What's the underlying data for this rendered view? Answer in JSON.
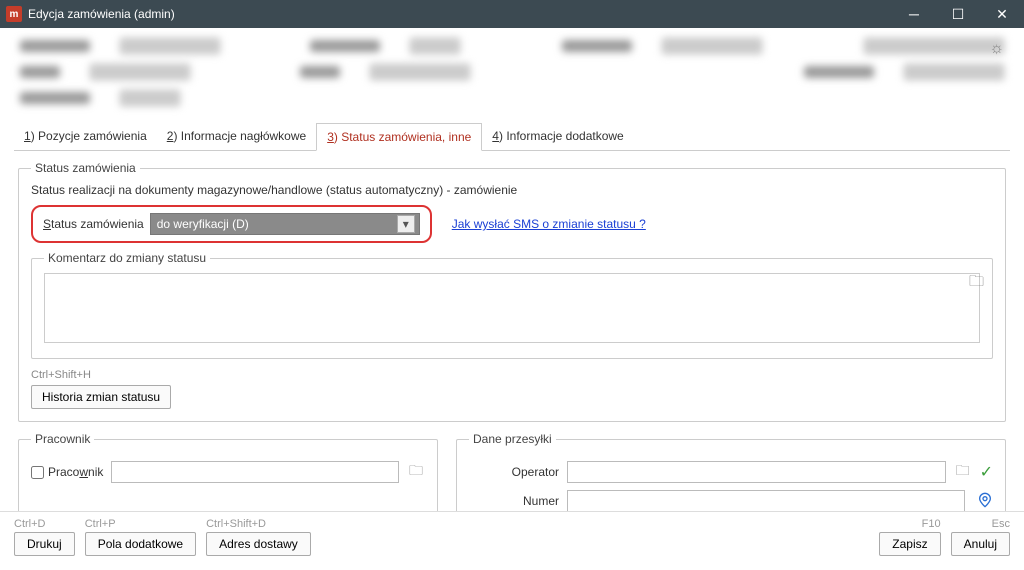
{
  "window": {
    "title": "Edycja zamówienia (admin)"
  },
  "tabs": [
    {
      "num": "1",
      "label": "Pozycje zamówienia"
    },
    {
      "num": "2",
      "label": "Informacje nagłówkowe"
    },
    {
      "num": "3",
      "label": "Status zamówienia, inne"
    },
    {
      "num": "4",
      "label": "Informacje dodatkowe"
    }
  ],
  "status": {
    "legend": "Status zamówienia",
    "auto_line": "Status realizacji na dokumenty magazynowe/handlowe (status automatyczny)  -  zamówienie",
    "field_label": "Status zamówienia",
    "field_label_ul": "S",
    "value": "do weryfikacji (D)",
    "sms_link": "Jak wysłać SMS o zmianie statusu ?",
    "comment_legend": "Komentarz do zmiany statusu",
    "comment_value": "",
    "shortcut": "Ctrl+Shift+H",
    "history_btn": "Historia zmian statusu"
  },
  "pracownik": {
    "legend": "Pracownik",
    "chk_label": "Pracownik",
    "chk_ul": "w",
    "value": ""
  },
  "dane": {
    "legend": "Dane przesyłki",
    "operator_label": "Operator",
    "operator_value": "",
    "numer_label": "Numer",
    "numer_value": ""
  },
  "footer": {
    "drukuj_sc": "Ctrl+D",
    "drukuj": "Drukuj",
    "pola_sc": "Ctrl+P",
    "pola": "Pola dodatkowe",
    "adres_sc": "Ctrl+Shift+D",
    "adres": "Adres dostawy",
    "zapisz_sc": "F10",
    "zapisz": "Zapisz",
    "anuluj_sc": "Esc",
    "anuluj": "Anuluj"
  }
}
